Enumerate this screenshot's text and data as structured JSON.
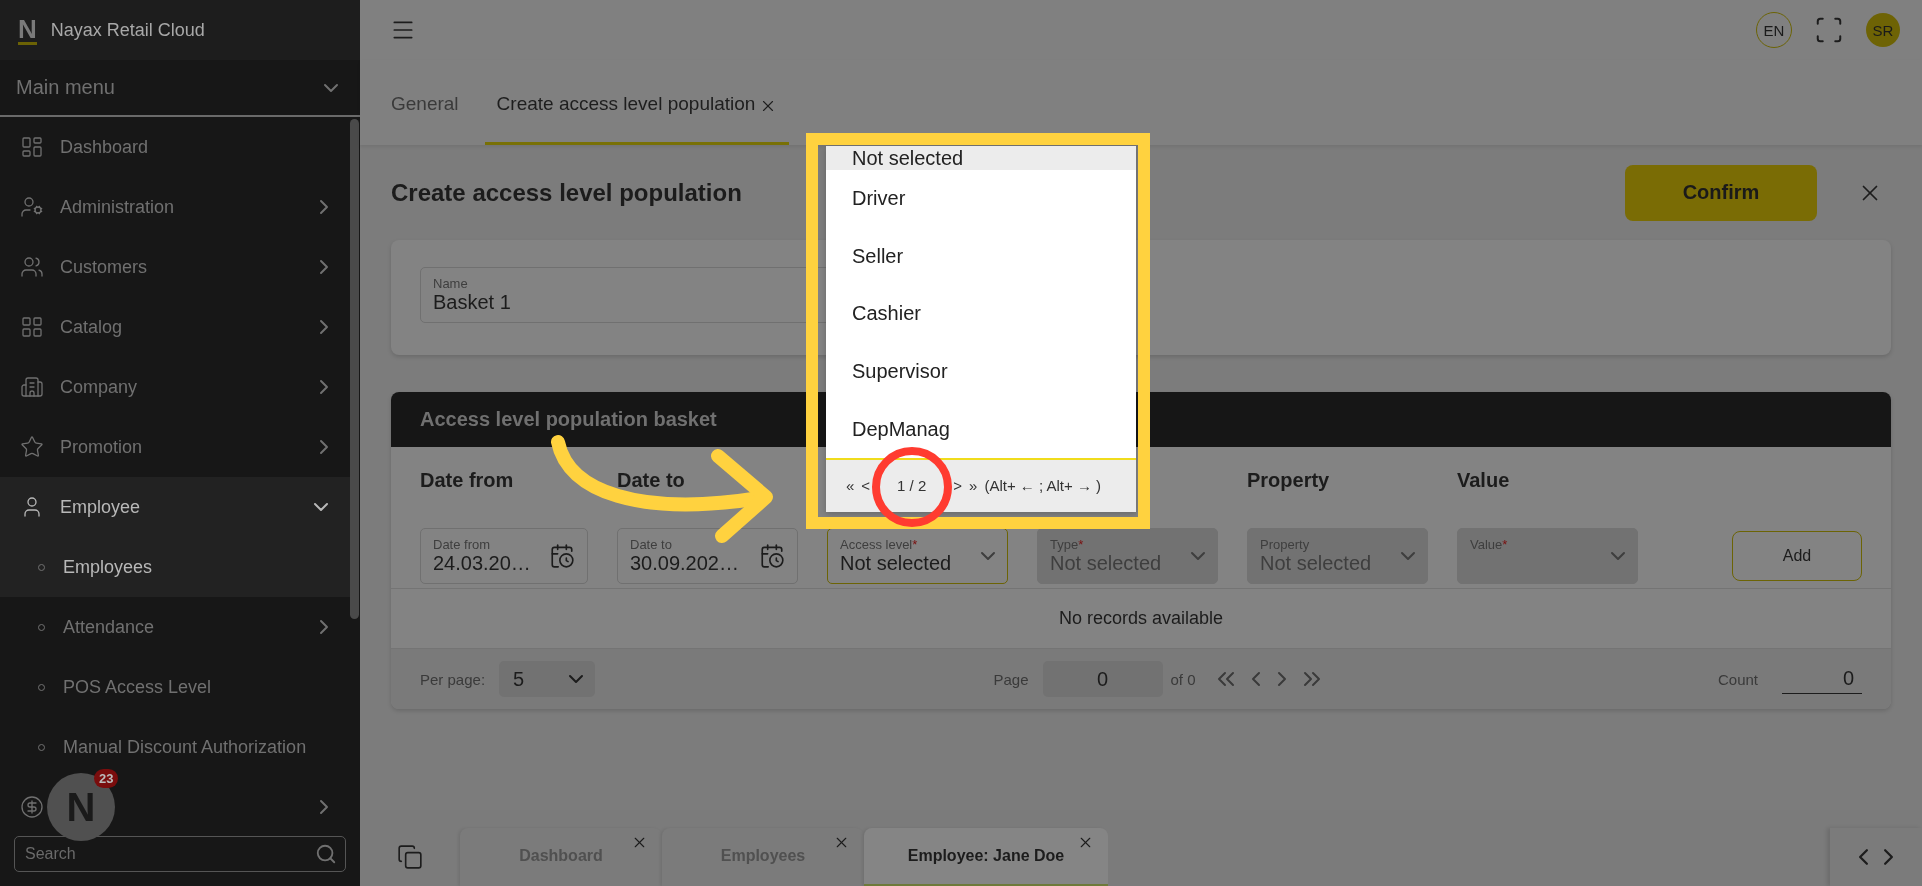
{
  "app": {
    "logo": "N",
    "name": "Nayax Retail Cloud"
  },
  "sidebar": {
    "menu_title": "Main menu",
    "items": [
      {
        "label": "Dashboard",
        "has_children": false,
        "selected": false
      },
      {
        "label": "Administration",
        "has_children": true,
        "expanded": false,
        "selected": false
      },
      {
        "label": "Customers",
        "has_children": true,
        "expanded": false,
        "selected": false
      },
      {
        "label": "Catalog",
        "has_children": true,
        "expanded": false,
        "selected": false
      },
      {
        "label": "Company",
        "has_children": true,
        "expanded": false,
        "selected": false
      },
      {
        "label": "Promotion",
        "has_children": true,
        "expanded": false,
        "selected": false
      },
      {
        "label": "Employee",
        "has_children": true,
        "expanded": true,
        "selected": true,
        "children": [
          {
            "label": "Employees",
            "has_children": false,
            "selected": true
          },
          {
            "label": "Attendance",
            "has_children": true,
            "selected": false
          },
          {
            "label": "POS Access Level",
            "has_children": false,
            "selected": false
          },
          {
            "label": "Manual Discount Authorization",
            "has_children": false,
            "selected": false
          }
        ]
      },
      {
        "has_children": true,
        "expanded": false,
        "selected": false
      }
    ],
    "search": {
      "placeholder": "Search"
    },
    "floating_button": {
      "logo": "N",
      "count": "23"
    }
  },
  "header": {
    "language": "EN",
    "user_initials": "SR"
  },
  "page_tabs": [
    {
      "label": "General",
      "selected": false,
      "closable": false
    },
    {
      "label": "Create access level population",
      "selected": true,
      "closable": true
    }
  ],
  "form": {
    "title": "Create access level population",
    "confirm": "Confirm",
    "name_field": {
      "label": "Name",
      "value": "Basket 1"
    }
  },
  "basket": {
    "title": "Access level population basket",
    "required_mark": "*",
    "filters": [
      {
        "kind": "date",
        "header": "Date from",
        "label": "Date from",
        "value": "24.03.20…"
      },
      {
        "kind": "date",
        "header": "Date to",
        "label": "Date to",
        "value": "30.09.202…"
      },
      {
        "kind": "select",
        "label": "Access level",
        "value": "Not selected",
        "required": true,
        "active": true
      },
      {
        "kind": "select",
        "label": "Type",
        "value": "Not selected",
        "required": true,
        "active": false
      },
      {
        "kind": "select",
        "header": "Property",
        "label": "Property",
        "value": "Not selected",
        "required": false,
        "active": false
      },
      {
        "kind": "select",
        "header": "Value",
        "label": "Value",
        "required": true,
        "active": false
      }
    ],
    "add": "Add",
    "empty": "No records available",
    "footer": {
      "per_page_label": "Per page:",
      "per_page": "5",
      "page_label": "Page",
      "page": "0",
      "of": "of 0",
      "count_label": "Count",
      "count": "0"
    }
  },
  "dropdown": {
    "options": [
      {
        "label": "Not selected",
        "selected": true
      },
      {
        "label": "Driver",
        "selected": false
      },
      {
        "label": "Seller",
        "selected": false
      },
      {
        "label": "Cashier",
        "selected": false
      },
      {
        "label": "Supervisor",
        "selected": false
      },
      {
        "label": "DepManag",
        "selected": false
      }
    ],
    "pager": {
      "first": "«",
      "prev": "<",
      "page": "1 / 2",
      "next": ">",
      "last": "»",
      "hint": "(Alt+ ← ; Alt+ → )"
    }
  },
  "bottom_tabs": [
    {
      "label": "Dashboard",
      "selected": false
    },
    {
      "label": "Employees",
      "selected": false
    },
    {
      "label": "Employee: Jane Doe",
      "selected": true
    }
  ]
}
